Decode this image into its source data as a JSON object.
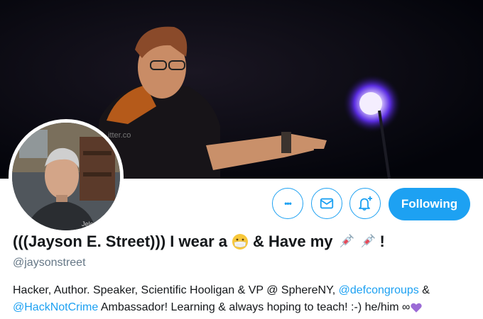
{
  "profile": {
    "name_prefix": "(((Jayson E. Street))) I wear a",
    "name_middle": "& Have my",
    "name_suffix": "!",
    "handle": "@jaysonstreet",
    "bio_part1": "Hacker, Author. Speaker, Scientific Hooligan & VP @ SphereNY, ",
    "bio_link1": "@defcongroups",
    "bio_part2": " & ",
    "bio_link2": "@HackNotCrime",
    "bio_part3": " Ambassador! Learning & always hoping to teach! :-) he/him ∞",
    "banner_overlay_text": "itter.co",
    "avatar_overlay_text": "Jeleron"
  },
  "actions": {
    "more_label": "•••",
    "following_label": "Following"
  },
  "colors": {
    "accent": "#1da1f2",
    "text": "#14171a",
    "secondary": "#657786",
    "heart": "#9b6bd6"
  },
  "icons": [
    "more-icon",
    "mail-icon",
    "bell-plus-icon",
    "mask-emoji-icon",
    "syringe-emoji-icon",
    "purple-heart-icon"
  ]
}
